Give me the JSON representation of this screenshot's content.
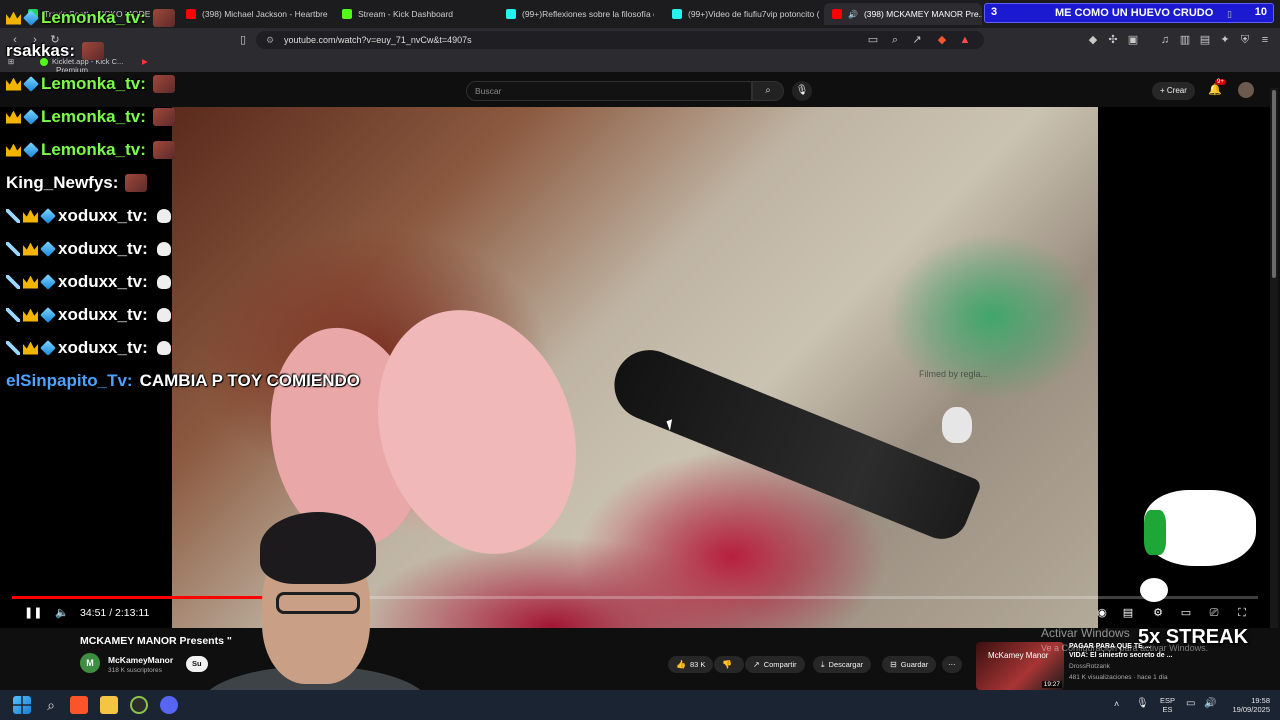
{
  "browser": {
    "tabs": [
      {
        "label": "Travis Scott - SICKO MODE (A...",
        "color": "#1ed760"
      },
      {
        "label": "(398) Michael Jackson - Heartbreak H...",
        "color": "#ff0000"
      },
      {
        "label": "Stream - Kick Dashboard",
        "color": "#53fc18"
      },
      {
        "label": "(99+)Reflexiones sobre la filosofía e...",
        "color": "#25f4ee"
      },
      {
        "label": "(99+)Video de fiufiu7vip potoncito (...",
        "color": "#25f4ee"
      },
      {
        "label": "(398) MCKAMEY MANOR Pre...",
        "color": "#ff0000"
      }
    ],
    "url": "youtube.com/watch?v=euy_71_nvCw&t=4907s",
    "bookmarks": [
      {
        "label": "Kicklet.app - Kick C..."
      },
      {
        "label": "Premium"
      }
    ]
  },
  "youtube": {
    "search_placeholder": "Buscar",
    "create_label": "Crear",
    "notif_badge": "9+",
    "video_watermark": "Filmed by regla...",
    "time_current": "34:51",
    "time_separator": "/",
    "time_total": "2:13:11",
    "progress_fraction": 0.262,
    "video_title": "MCKAMEY MANOR Presents \"",
    "channel_name": "McKameyManor",
    "channel_initial": "M",
    "channel_subs": "318 K suscriptores",
    "subscribe_label": "Su",
    "likes": "83 K",
    "share_label": "Compartir",
    "download_label": "Descargar",
    "save_label": "Guardar",
    "recommended": {
      "thumb_text": "McKamey Manor",
      "title_line1": "PAGAR PARA QUE TE ...",
      "title_line2": "VIDA: El siniestro secreto de ...",
      "channel": "DrossRotzank",
      "meta": "481 K visualizaciones · hace 1 día",
      "duration": "19:27"
    }
  },
  "chat": [
    {
      "user": "Lemonka_tv:",
      "color": "#7cfc4a",
      "badges": [
        "crown",
        "cube"
      ],
      "emote": true,
      "msg": ""
    },
    {
      "user": "rsakkas:",
      "color": "#ffffff",
      "badges": [],
      "emote": true,
      "msg": ""
    },
    {
      "user": "Lemonka_tv:",
      "color": "#7cfc4a",
      "badges": [
        "crown",
        "cube"
      ],
      "emote": true,
      "msg": ""
    },
    {
      "user": "Lemonka_tv:",
      "color": "#7cfc4a",
      "badges": [
        "crown",
        "cube"
      ],
      "emote": true,
      "msg": ""
    },
    {
      "user": "Lemonka_tv:",
      "color": "#7cfc4a",
      "badges": [
        "crown",
        "cube"
      ],
      "emote": true,
      "msg": ""
    },
    {
      "user": "King_Newfys:",
      "color": "#ffffff",
      "badges": [],
      "emote": true,
      "msg": ""
    },
    {
      "user": "xoduxx_tv:",
      "color": "#ffffff",
      "badges": [
        "sword",
        "crown",
        "cube"
      ],
      "skull": true,
      "msg": ""
    },
    {
      "user": "xoduxx_tv:",
      "color": "#ffffff",
      "badges": [
        "sword",
        "crown",
        "cube"
      ],
      "skull": true,
      "msg": ""
    },
    {
      "user": "xoduxx_tv:",
      "color": "#ffffff",
      "badges": [
        "sword",
        "crown",
        "cube"
      ],
      "skull": true,
      "msg": ""
    },
    {
      "user": "xoduxx_tv:",
      "color": "#ffffff",
      "badges": [
        "sword",
        "crown",
        "cube"
      ],
      "skull": true,
      "msg": ""
    },
    {
      "user": "xoduxx_tv:",
      "color": "#ffffff",
      "badges": [
        "sword",
        "crown",
        "cube"
      ],
      "skull": true,
      "msg": ""
    },
    {
      "user": "elSinpapito_Tv:",
      "color": "#4da3ff",
      "badges": [],
      "msg": "CAMBIA P TOY COMIENDO"
    }
  ],
  "overlay": {
    "goal_count": "3",
    "goal_text": "ME COMO UN HUEVO CRUDO",
    "goal_target": "10",
    "streak_text": "5x STREAK",
    "activate_windows_line1": "Activar Windows",
    "activate_windows_line2": "Ve a Configuración para activar Windows."
  },
  "taskbar": {
    "lang_line1": "ESP",
    "lang_line2": "ES",
    "time": "19:58",
    "date": "19/09/2025"
  }
}
